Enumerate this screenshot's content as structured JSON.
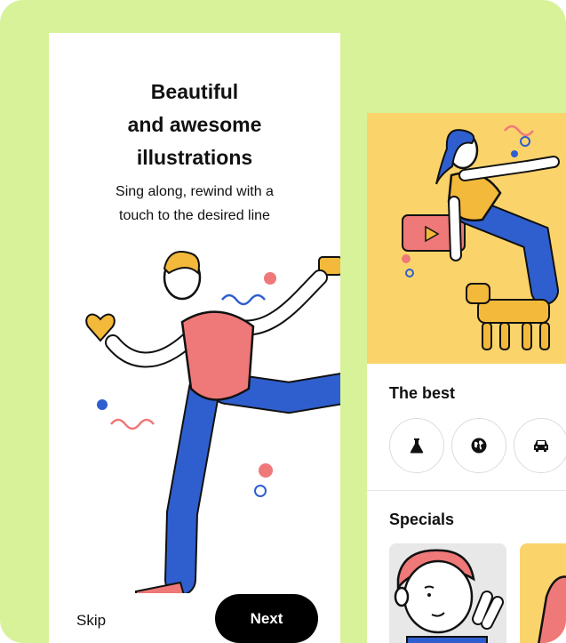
{
  "onboarding": {
    "title_line1": "Beautiful",
    "title_line2": "and awesome",
    "title_line3": "illustrations",
    "subtitle_line1": "Sing along, rewind with a",
    "subtitle_line2": "touch to the desired line",
    "skip_label": "Skip",
    "next_label": "Next"
  },
  "preview": {
    "the_best_title": "The best",
    "categories": [
      {
        "icon": "flask-icon"
      },
      {
        "icon": "globe-icon"
      },
      {
        "icon": "car-icon"
      }
    ],
    "specials_title": "Specials"
  },
  "colors": {
    "background": "#d8f29a",
    "hero": "#fbd36b",
    "button": "#000000",
    "skin": "#ffffff",
    "shirt": "#ef7878",
    "pants": "#2f5fcf"
  }
}
